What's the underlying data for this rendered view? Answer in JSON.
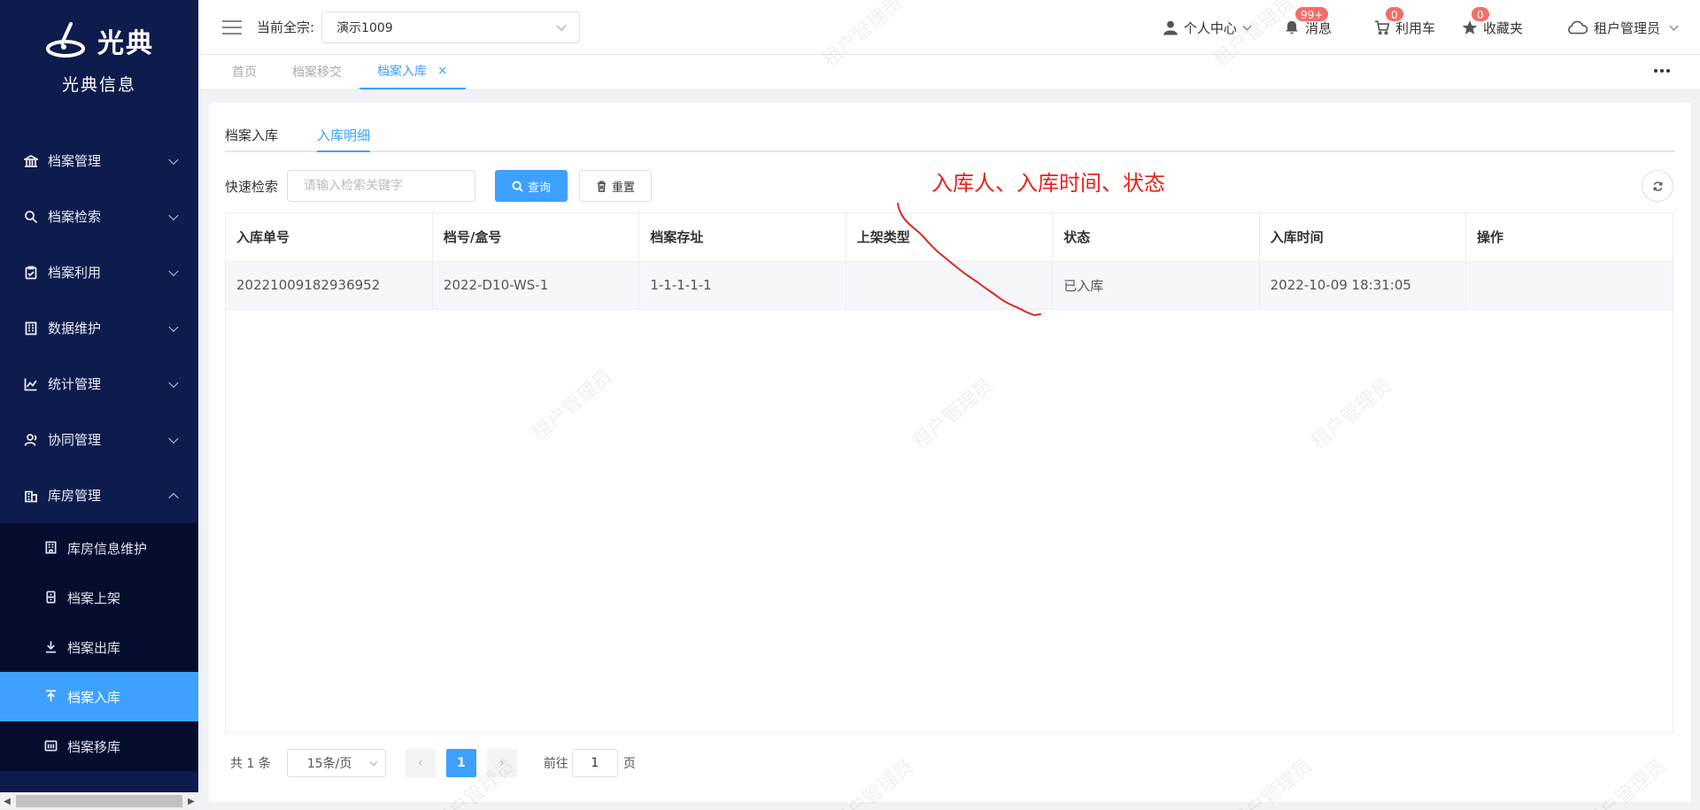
{
  "brand": {
    "logo_text": "光典",
    "subtitle": "光典信息"
  },
  "sidebar": {
    "items": [
      {
        "label": "档案管理",
        "icon": "bank-icon"
      },
      {
        "label": "档案检索",
        "icon": "search-icon"
      },
      {
        "label": "档案利用",
        "icon": "clipboard-icon"
      },
      {
        "label": "数据维护",
        "icon": "building-icon"
      },
      {
        "label": "统计管理",
        "icon": "chart-icon"
      },
      {
        "label": "协同管理",
        "icon": "user-group-icon"
      },
      {
        "label": "库房管理",
        "icon": "warehouse-icon"
      }
    ],
    "sub_items": [
      {
        "label": "库房信息维护",
        "icon": "building-icon"
      },
      {
        "label": "档案上架",
        "icon": "cabinet-icon"
      },
      {
        "label": "档案出库",
        "icon": "download-icon"
      },
      {
        "label": "档案入库",
        "icon": "upload-icon"
      },
      {
        "label": "档案移库",
        "icon": "transfer-icon"
      }
    ],
    "active_sub": "档案入库"
  },
  "header": {
    "current_label": "当前全宗:",
    "current_value": "演示1009",
    "personal_center": "个人中心",
    "messages": "消息",
    "messages_badge": "99+",
    "cart": "利用车",
    "cart_badge": "0",
    "favorites": "收藏夹",
    "favorites_badge": "0",
    "user": "租户管理员"
  },
  "tags": [
    {
      "label": "首页"
    },
    {
      "label": "档案移交"
    },
    {
      "label": "档案入库",
      "active": true
    }
  ],
  "inner_tabs": [
    {
      "label": "档案入库"
    },
    {
      "label": "入库明细",
      "active": true
    }
  ],
  "search": {
    "label": "快速检索",
    "placeholder": "请输入检索关键字",
    "query_button": "查询",
    "reset_button": "重置"
  },
  "annotation": "入库人、入库时间、状态",
  "table": {
    "columns": [
      "入库单号",
      "档号/盒号",
      "档案存址",
      "上架类型",
      "状态",
      "入库时间",
      "操作"
    ],
    "rows": [
      [
        "20221009182936952",
        "2022-D10-WS-1",
        "1-1-1-1-1",
        "",
        "已入库",
        "2022-10-09 18:31:05",
        ""
      ]
    ]
  },
  "pagination": {
    "total_text": "共 1 条",
    "page_size": "15条/页",
    "current_page": "1",
    "goto_label": "前往",
    "goto_value": "1",
    "goto_suffix": "页"
  },
  "watermark_text": "租户管理员",
  "colors": {
    "sidebar_bg": "#0e1b4d",
    "accent": "#3ea0ff",
    "annotation": "#e6231c",
    "badge": "#f56c6c"
  }
}
